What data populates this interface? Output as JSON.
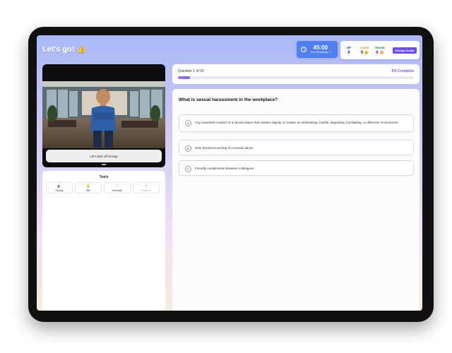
{
  "header": {
    "title": "Let's go!",
    "title_emoji": "👍"
  },
  "timer": {
    "time": "45:00",
    "label": "Time Remaining ⓘ"
  },
  "stats": {
    "xp": {
      "label": "XP",
      "value": "0",
      "color": "#1b3a8a"
    },
    "coins": {
      "label": "Coins",
      "value": "0",
      "color": "#e08a14"
    },
    "streak": {
      "label": "Streak",
      "value": "0",
      "color": "#1f8a3a"
    },
    "change_avatar_label": "Change Avatar"
  },
  "video": {
    "caption": "Let's kick off strong!"
  },
  "tools": {
    "title": "Tools",
    "items": [
      {
        "label": "Replay",
        "icon": "speaker-icon",
        "glyph": "🔈",
        "enabled": true
      },
      {
        "label": "Hint",
        "icon": "lightbulb-icon",
        "glyph": "💡",
        "enabled": true
      },
      {
        "label": "Motivate",
        "icon": "heart-icon",
        "glyph": "♡",
        "enabled": true
      },
      {
        "label": "Previous",
        "icon": "undo-icon",
        "glyph": "↺",
        "enabled": false
      }
    ]
  },
  "progress": {
    "question_label": "Question 1 of 20",
    "complete_label": "5% Complete",
    "fraction": 0.05
  },
  "question": {
    "text": "What is sexual harassment in the workplace?",
    "options": [
      {
        "letter": "A",
        "text": "Any unwanted conduct of a sexual nature that violates dignity or creates an intimidating, hostile, degrading, humiliating, or offensive environment."
      },
      {
        "letter": "B",
        "text": "Only physical touching of a sexual nature."
      },
      {
        "letter": "C",
        "text": "Friendly compliments between colleagues."
      }
    ]
  },
  "colors": {
    "accent": "#6d4ee6",
    "timer": "#4f7ff0",
    "progress": "#a46ff0"
  }
}
